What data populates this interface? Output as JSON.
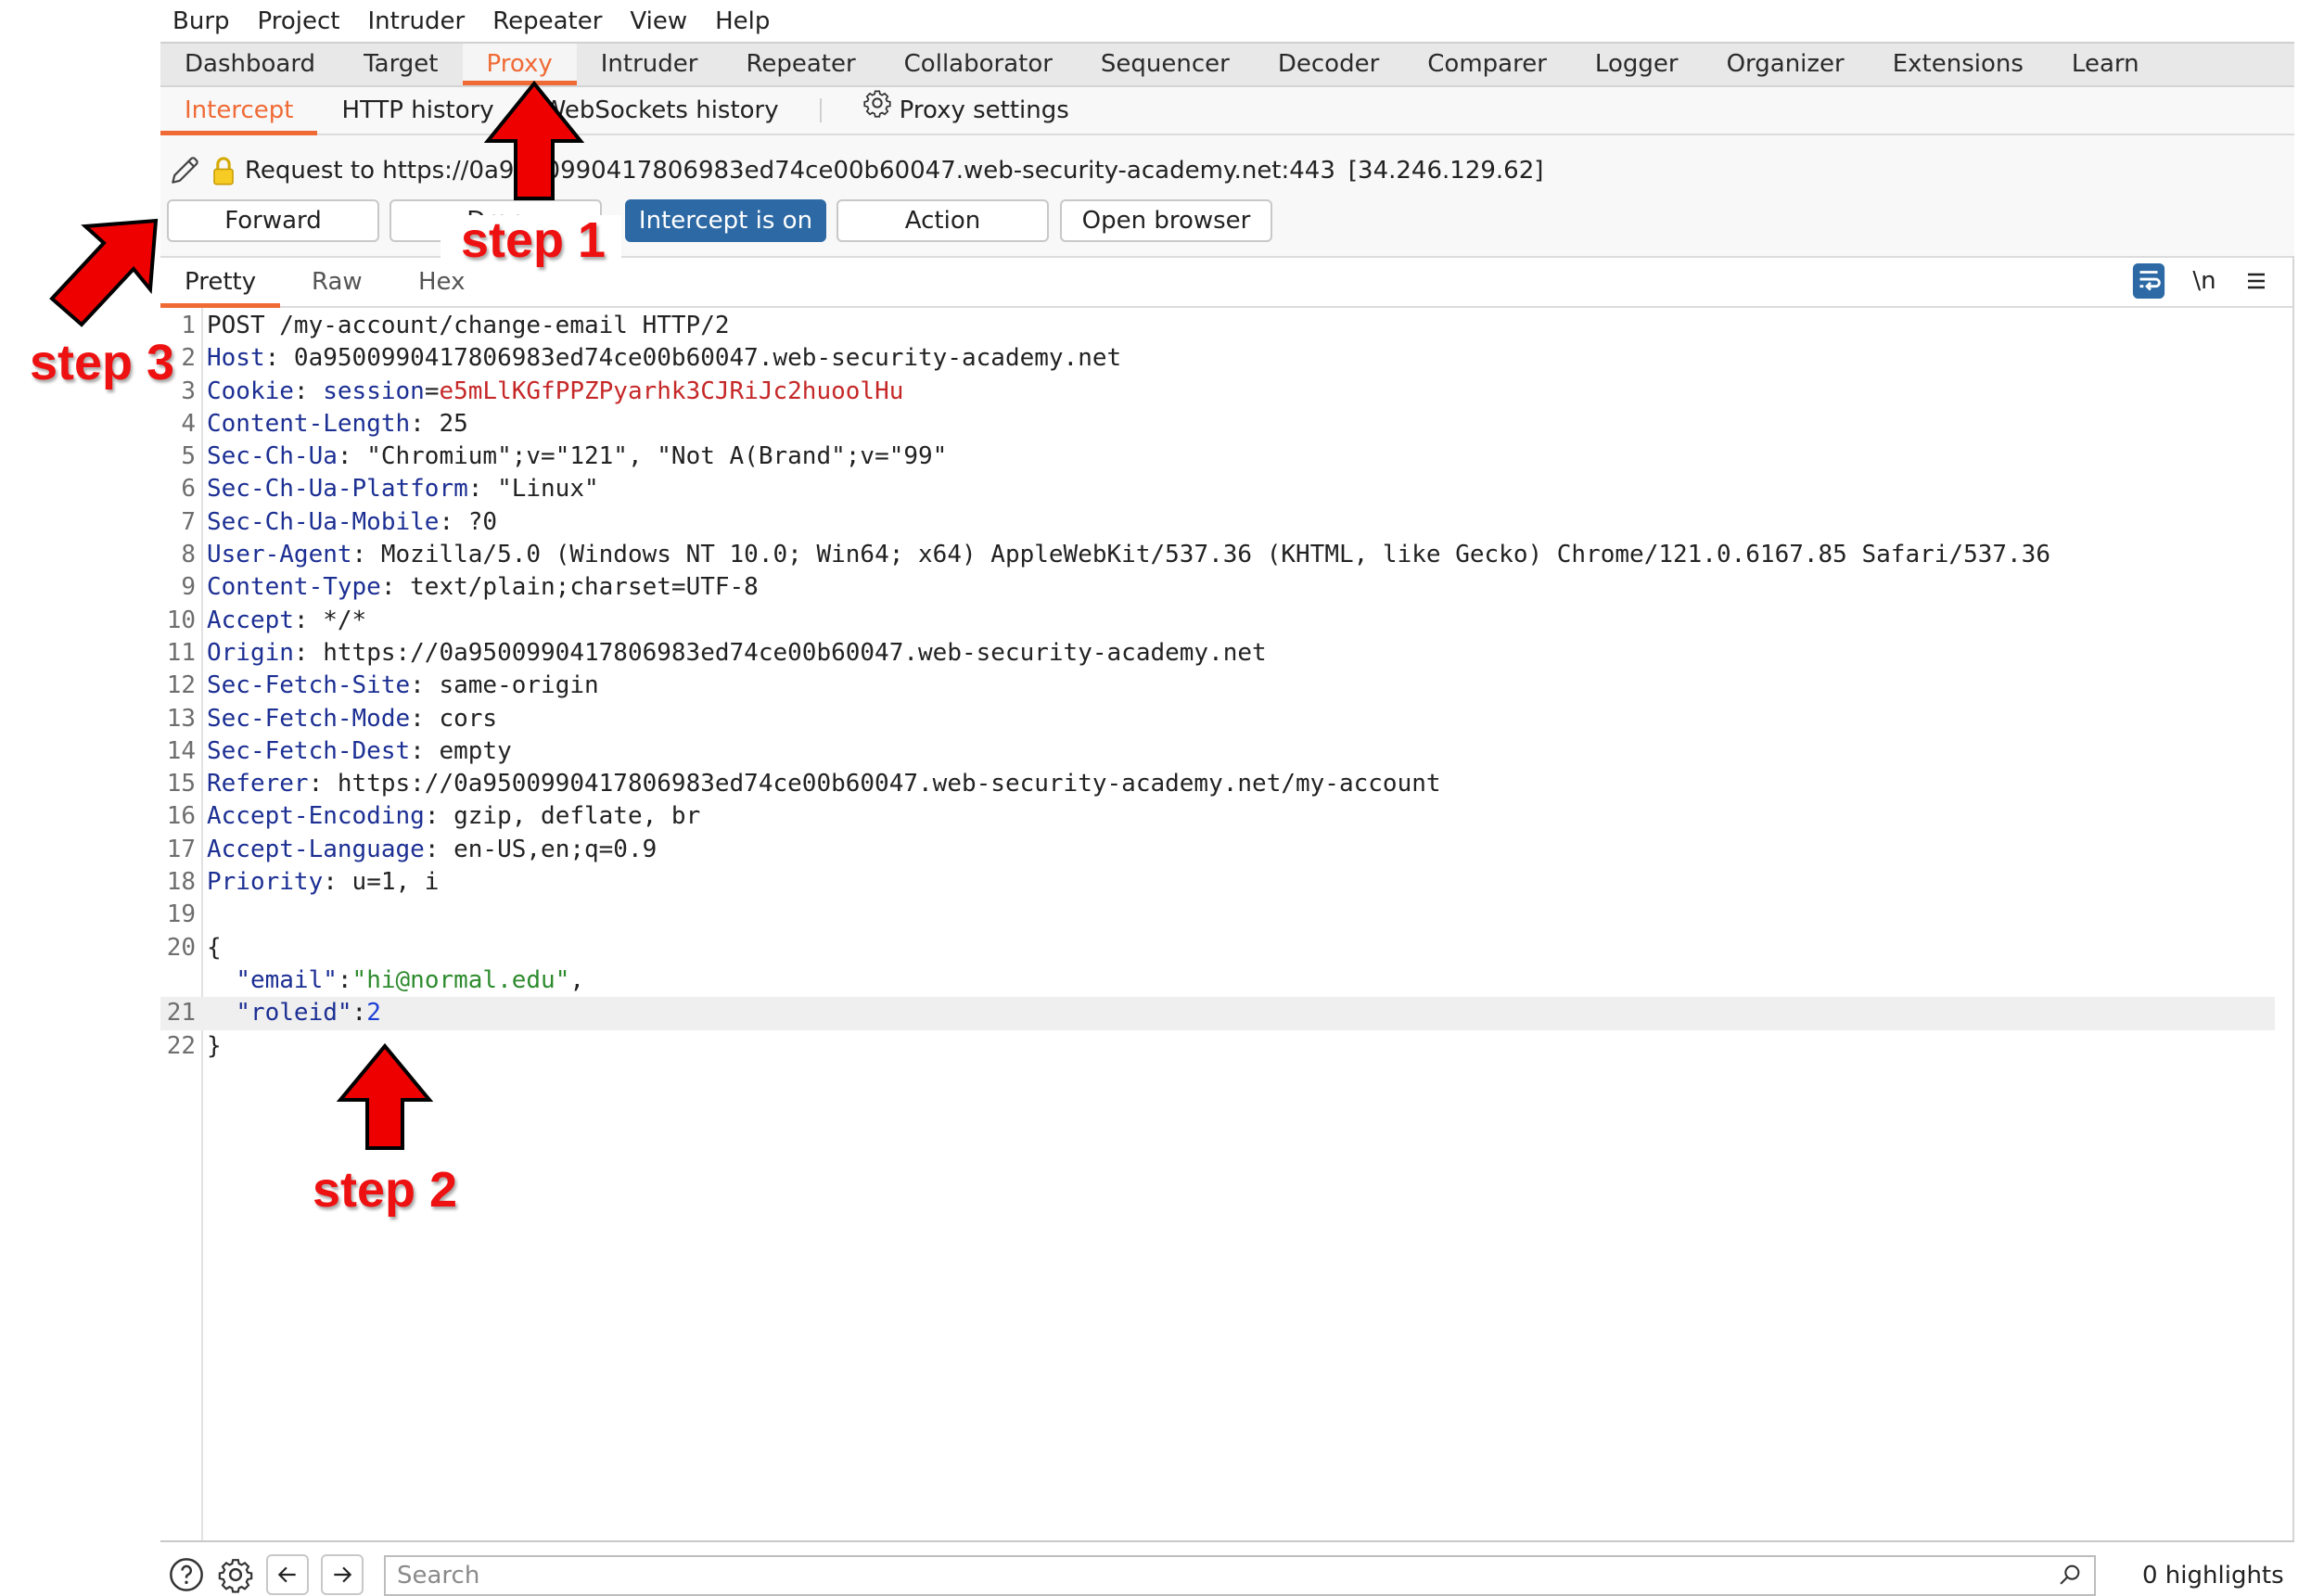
{
  "menubar": [
    "Burp",
    "Project",
    "Intruder",
    "Repeater",
    "View",
    "Help"
  ],
  "main_tabs": [
    {
      "label": "Dashboard",
      "active": false
    },
    {
      "label": "Target",
      "active": false
    },
    {
      "label": "Proxy",
      "active": true
    },
    {
      "label": "Intruder",
      "active": false
    },
    {
      "label": "Repeater",
      "active": false
    },
    {
      "label": "Collaborator",
      "active": false
    },
    {
      "label": "Sequencer",
      "active": false
    },
    {
      "label": "Decoder",
      "active": false
    },
    {
      "label": "Comparer",
      "active": false
    },
    {
      "label": "Logger",
      "active": false
    },
    {
      "label": "Organizer",
      "active": false
    },
    {
      "label": "Extensions",
      "active": false
    },
    {
      "label": "Learn",
      "active": false
    }
  ],
  "sub_tabs": {
    "intercept": "Intercept",
    "http_history": "HTTP history",
    "websockets_history": "WebSockets history",
    "proxy_settings": "Proxy settings"
  },
  "request": {
    "label": "Request to https://0a9500990417806983ed74ce00b60047.web-security-academy.net:443",
    "ip": "[34.246.129.62]"
  },
  "buttons": {
    "forward": "Forward",
    "drop": "Drop",
    "intercept": "Intercept is on",
    "action": "Action",
    "open_browser": "Open browser"
  },
  "editor_tabs": {
    "pretty": "Pretty",
    "raw": "Raw",
    "hex": "Hex"
  },
  "editor_tools": {
    "newline": "\\n"
  },
  "code_lines": [
    {
      "n": "1",
      "parts": [
        {
          "t": "POST /my-account/change-email HTTP/2",
          "c": "v"
        }
      ]
    },
    {
      "n": "2",
      "parts": [
        {
          "t": "Host",
          "c": "k"
        },
        {
          "t": ": 0a9500990417806983ed74ce00b60047.web-security-academy.net",
          "c": "v"
        }
      ]
    },
    {
      "n": "3",
      "parts": [
        {
          "t": "Cookie",
          "c": "k"
        },
        {
          "t": ": ",
          "c": "v"
        },
        {
          "t": "session",
          "c": "k"
        },
        {
          "t": "=",
          "c": "v"
        },
        {
          "t": "e5mLlKGfPPZPyarhk3CJRiJc2huoolHu",
          "c": "s"
        }
      ]
    },
    {
      "n": "4",
      "parts": [
        {
          "t": "Content-Length",
          "c": "k"
        },
        {
          "t": ": 25",
          "c": "v"
        }
      ]
    },
    {
      "n": "5",
      "parts": [
        {
          "t": "Sec-Ch-Ua",
          "c": "k"
        },
        {
          "t": ": \"Chromium\";v=\"121\", \"Not A(Brand\";v=\"99\"",
          "c": "v"
        }
      ]
    },
    {
      "n": "6",
      "parts": [
        {
          "t": "Sec-Ch-Ua-Platform",
          "c": "k"
        },
        {
          "t": ": \"Linux\"",
          "c": "v"
        }
      ]
    },
    {
      "n": "7",
      "parts": [
        {
          "t": "Sec-Ch-Ua-Mobile",
          "c": "k"
        },
        {
          "t": ": ?0",
          "c": "v"
        }
      ]
    },
    {
      "n": "8",
      "parts": [
        {
          "t": "User-Agent",
          "c": "k"
        },
        {
          "t": ": Mozilla/5.0 (Windows NT 10.0; Win64; x64) AppleWebKit/537.36 (KHTML, like Gecko) Chrome/121.0.6167.85 Safari/537.36",
          "c": "v"
        }
      ]
    },
    {
      "n": "9",
      "parts": [
        {
          "t": "Content-Type",
          "c": "k"
        },
        {
          "t": ": text/plain;charset=UTF-8",
          "c": "v"
        }
      ]
    },
    {
      "n": "10",
      "parts": [
        {
          "t": "Accept",
          "c": "k"
        },
        {
          "t": ": */*",
          "c": "v"
        }
      ]
    },
    {
      "n": "11",
      "parts": [
        {
          "t": "Origin",
          "c": "k"
        },
        {
          "t": ": https://0a9500990417806983ed74ce00b60047.web-security-academy.net",
          "c": "v"
        }
      ]
    },
    {
      "n": "12",
      "parts": [
        {
          "t": "Sec-Fetch-Site",
          "c": "k"
        },
        {
          "t": ": same-origin",
          "c": "v"
        }
      ]
    },
    {
      "n": "13",
      "parts": [
        {
          "t": "Sec-Fetch-Mode",
          "c": "k"
        },
        {
          "t": ": cors",
          "c": "v"
        }
      ]
    },
    {
      "n": "14",
      "parts": [
        {
          "t": "Sec-Fetch-Dest",
          "c": "k"
        },
        {
          "t": ": empty",
          "c": "v"
        }
      ]
    },
    {
      "n": "15",
      "parts": [
        {
          "t": "Referer",
          "c": "k"
        },
        {
          "t": ": https://0a9500990417806983ed74ce00b60047.web-security-academy.net/my-account",
          "c": "v"
        }
      ]
    },
    {
      "n": "16",
      "parts": [
        {
          "t": "Accept-Encoding",
          "c": "k"
        },
        {
          "t": ": gzip, deflate, br",
          "c": "v"
        }
      ]
    },
    {
      "n": "17",
      "parts": [
        {
          "t": "Accept-Language",
          "c": "k"
        },
        {
          "t": ": en-US,en;q=0.9",
          "c": "v"
        }
      ]
    },
    {
      "n": "18",
      "parts": [
        {
          "t": "Priority",
          "c": "k"
        },
        {
          "t": ": u=1, i",
          "c": "v"
        }
      ]
    },
    {
      "n": "19",
      "parts": []
    },
    {
      "n": "20",
      "parts": [
        {
          "t": "{",
          "c": "v"
        }
      ]
    },
    {
      "n": "",
      "parts": [
        {
          "t": "  ",
          "c": "v"
        },
        {
          "t": "\"email\"",
          "c": "j"
        },
        {
          "t": ":",
          "c": "v"
        },
        {
          "t": "\"hi@normal.edu\"",
          "c": "jstr"
        },
        {
          "t": ",",
          "c": "v"
        }
      ]
    },
    {
      "n": "21",
      "highlight": true,
      "parts": [
        {
          "t": "  ",
          "c": "v"
        },
        {
          "t": "\"roleid\"",
          "c": "j"
        },
        {
          "t": ":",
          "c": "v"
        },
        {
          "t": "2",
          "c": "jnum"
        }
      ]
    },
    {
      "n": "22",
      "parts": [
        {
          "t": "}",
          "c": "v"
        }
      ]
    }
  ],
  "bottom": {
    "search_placeholder": "Search",
    "highlights": "0 highlights"
  },
  "annotations": {
    "step1": "step 1",
    "step2": "step 2",
    "step3": "step 3"
  },
  "colors": {
    "accent": "#f06a35",
    "intercept_on": "#2d6aa5",
    "header_key": "#1c2f93",
    "cookie_value": "#c62828",
    "json_string": "#2e8b2e",
    "json_number": "#1d3fd6",
    "annotation": "#ee1111"
  }
}
